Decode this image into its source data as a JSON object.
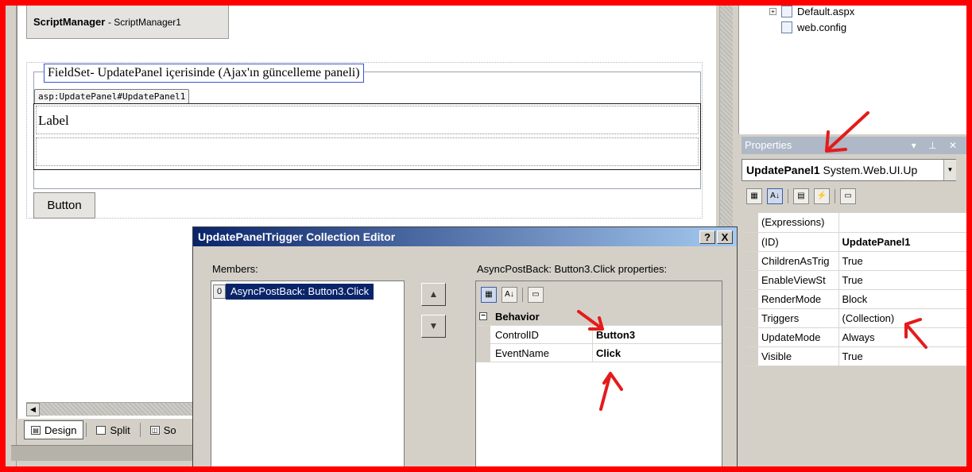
{
  "designer": {
    "script_manager": {
      "type": "ScriptManager",
      "name": "- ScriptManager1"
    },
    "fieldset_legend": "FieldSet- UpdatePanel içerisinde (Ajax'ın güncelleme paneli)",
    "update_panel_tag": "asp:UpdatePanel#UpdatePanel1",
    "label_text": "Label",
    "button_text": "Button"
  },
  "view_tabs": [
    {
      "label": "Design",
      "active": true
    },
    {
      "label": "Split",
      "active": false
    },
    {
      "label": "So",
      "active": false
    }
  ],
  "solution_explorer": {
    "items": [
      "Default.aspx",
      "web.config"
    ]
  },
  "properties": {
    "title": "Properties",
    "title_controls": "▾ ⊥ ✕",
    "object_name": "UpdatePanel1",
    "object_type": "System.Web.UI.Up",
    "rows": [
      {
        "key": "(Expressions)",
        "value": "",
        "bold": false
      },
      {
        "key": "(ID)",
        "value": "UpdatePanel1",
        "bold": true
      },
      {
        "key": "ChildrenAsTrig",
        "value": "True",
        "bold": false
      },
      {
        "key": "EnableViewSt",
        "value": "True",
        "bold": false
      },
      {
        "key": "RenderMode",
        "value": "Block",
        "bold": false
      },
      {
        "key": "Triggers",
        "value": "(Collection)",
        "bold": false
      },
      {
        "key": "UpdateMode",
        "value": "Always",
        "bold": false
      },
      {
        "key": "Visible",
        "value": "True",
        "bold": false
      }
    ]
  },
  "dialog": {
    "title": "UpdatePanelTrigger Collection Editor",
    "help": "?",
    "close": "X",
    "members_label": "Members:",
    "members": [
      {
        "index": "0",
        "text": "AsyncPostBack: Button3.Click"
      }
    ],
    "props_label": "AsyncPostBack: Button3.Click properties:",
    "category": "Behavior",
    "grid": [
      {
        "key": "ControlID",
        "value": "Button3"
      },
      {
        "key": "EventName",
        "value": "Click"
      }
    ]
  },
  "colors": {
    "annotation": "#ff0000",
    "titlebar_start": "#0a246a",
    "titlebar_end": "#a6caf0",
    "selection": "#0a246a"
  }
}
